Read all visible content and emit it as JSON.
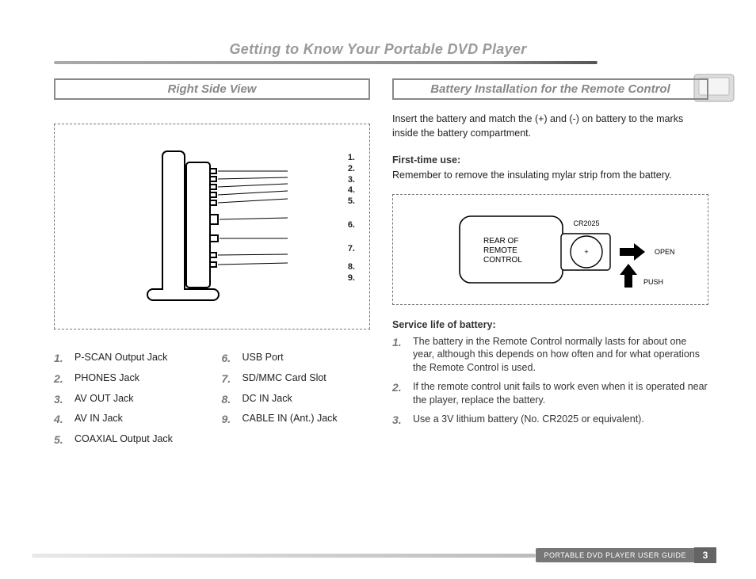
{
  "page": {
    "title": "Getting to Know Your Portable DVD Player",
    "footer_label": "PORTABLE DVD PLAYER USER GUIDE",
    "page_number": "3"
  },
  "left": {
    "header": "Right Side View",
    "callouts": [
      "1.",
      "2.",
      "3.",
      "4.",
      "5.",
      "6.",
      "7.",
      "8.",
      "9."
    ],
    "legend_a": [
      {
        "n": "1.",
        "t": "P-SCAN Output Jack"
      },
      {
        "n": "2.",
        "t": "PHONES Jack"
      },
      {
        "n": "3.",
        "t": "AV OUT Jack"
      },
      {
        "n": "4.",
        "t": "AV IN Jack"
      },
      {
        "n": "5.",
        "t": "COAXIAL Output Jack"
      }
    ],
    "legend_b": [
      {
        "n": "6.",
        "t": "USB Port"
      },
      {
        "n": "7.",
        "t": "SD/MMC Card Slot"
      },
      {
        "n": "8.",
        "t": "DC IN Jack"
      },
      {
        "n": "9.",
        "t": "CABLE IN (Ant.) Jack"
      }
    ]
  },
  "right": {
    "header": "Battery Installation for the Remote Control",
    "intro": "Insert the battery and match the (+) and (-) on battery to the marks inside the battery compartment.",
    "first_use_head": "First-time use:",
    "first_use_body": "Remember to remove the insulating mylar strip from the battery.",
    "remote_labels": {
      "rear": "REAR OF REMOTE CONTROL",
      "battery": "CR2025",
      "open": "OPEN",
      "push": "PUSH"
    },
    "service_head": "Service life of battery:",
    "service_items": [
      {
        "n": "1.",
        "t": "The battery in the Remote Control normally lasts for about one year, although this depends on how often and for what operations the Remote Control is used."
      },
      {
        "n": "2.",
        "t": "If the remote control unit fails to work even when it is operated near the player, replace the battery."
      },
      {
        "n": "3.",
        "t": "Use a 3V lithium battery (No. CR2025 or equivalent)."
      }
    ]
  }
}
